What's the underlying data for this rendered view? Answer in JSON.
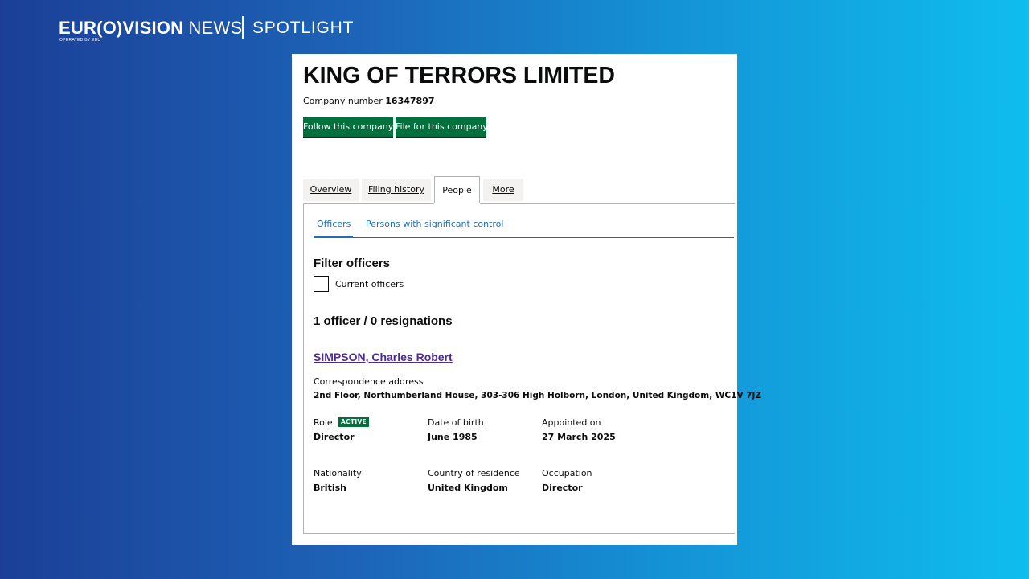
{
  "brand": {
    "euro_bold_left": "EUR",
    "euro_o": "(O)",
    "euro_bold_right": "VISION",
    "news": "NEWS",
    "sub": "OPERATED BY EBU",
    "spotlight": "SPOTLIGHT"
  },
  "company": {
    "name": "KING OF TERRORS LIMITED",
    "number_label": "Company number",
    "number": "16347897"
  },
  "buttons": {
    "follow": "Follow this company",
    "file": "File for this company"
  },
  "tabs": [
    {
      "label": "Overview",
      "active": false
    },
    {
      "label": "Filing history",
      "active": false
    },
    {
      "label": "People",
      "active": true
    },
    {
      "label": "More",
      "active": false
    }
  ],
  "subtabs": [
    {
      "label": "Officers",
      "active": true
    },
    {
      "label": "Persons with significant control",
      "active": false
    }
  ],
  "filter": {
    "heading": "Filter officers",
    "checkbox_label": "Current officers",
    "checked": false
  },
  "summary": "1 officer / 0 resignations",
  "officer": {
    "name": "SIMPSON, Charles Robert",
    "address_label": "Correspondence address",
    "address": "2nd Floor, Northumberland House, 303-306 High Holborn, London, United Kingdom, WC1V 7JZ",
    "role_label": "Role",
    "status": "ACTIVE",
    "role": "Director",
    "dob_label": "Date of birth",
    "dob": "June 1985",
    "appointed_label": "Appointed on",
    "appointed": "27 March 2025",
    "nationality_label": "Nationality",
    "nationality": "British",
    "residence_label": "Country of residence",
    "residence": "United Kingdom",
    "occupation_label": "Occupation",
    "occupation": "Director"
  },
  "colors": {
    "button_green": "#00703c",
    "link_blue": "#1d70b8",
    "visited_purple": "#4c2c92",
    "tab_grey": "#f3f2f1"
  }
}
